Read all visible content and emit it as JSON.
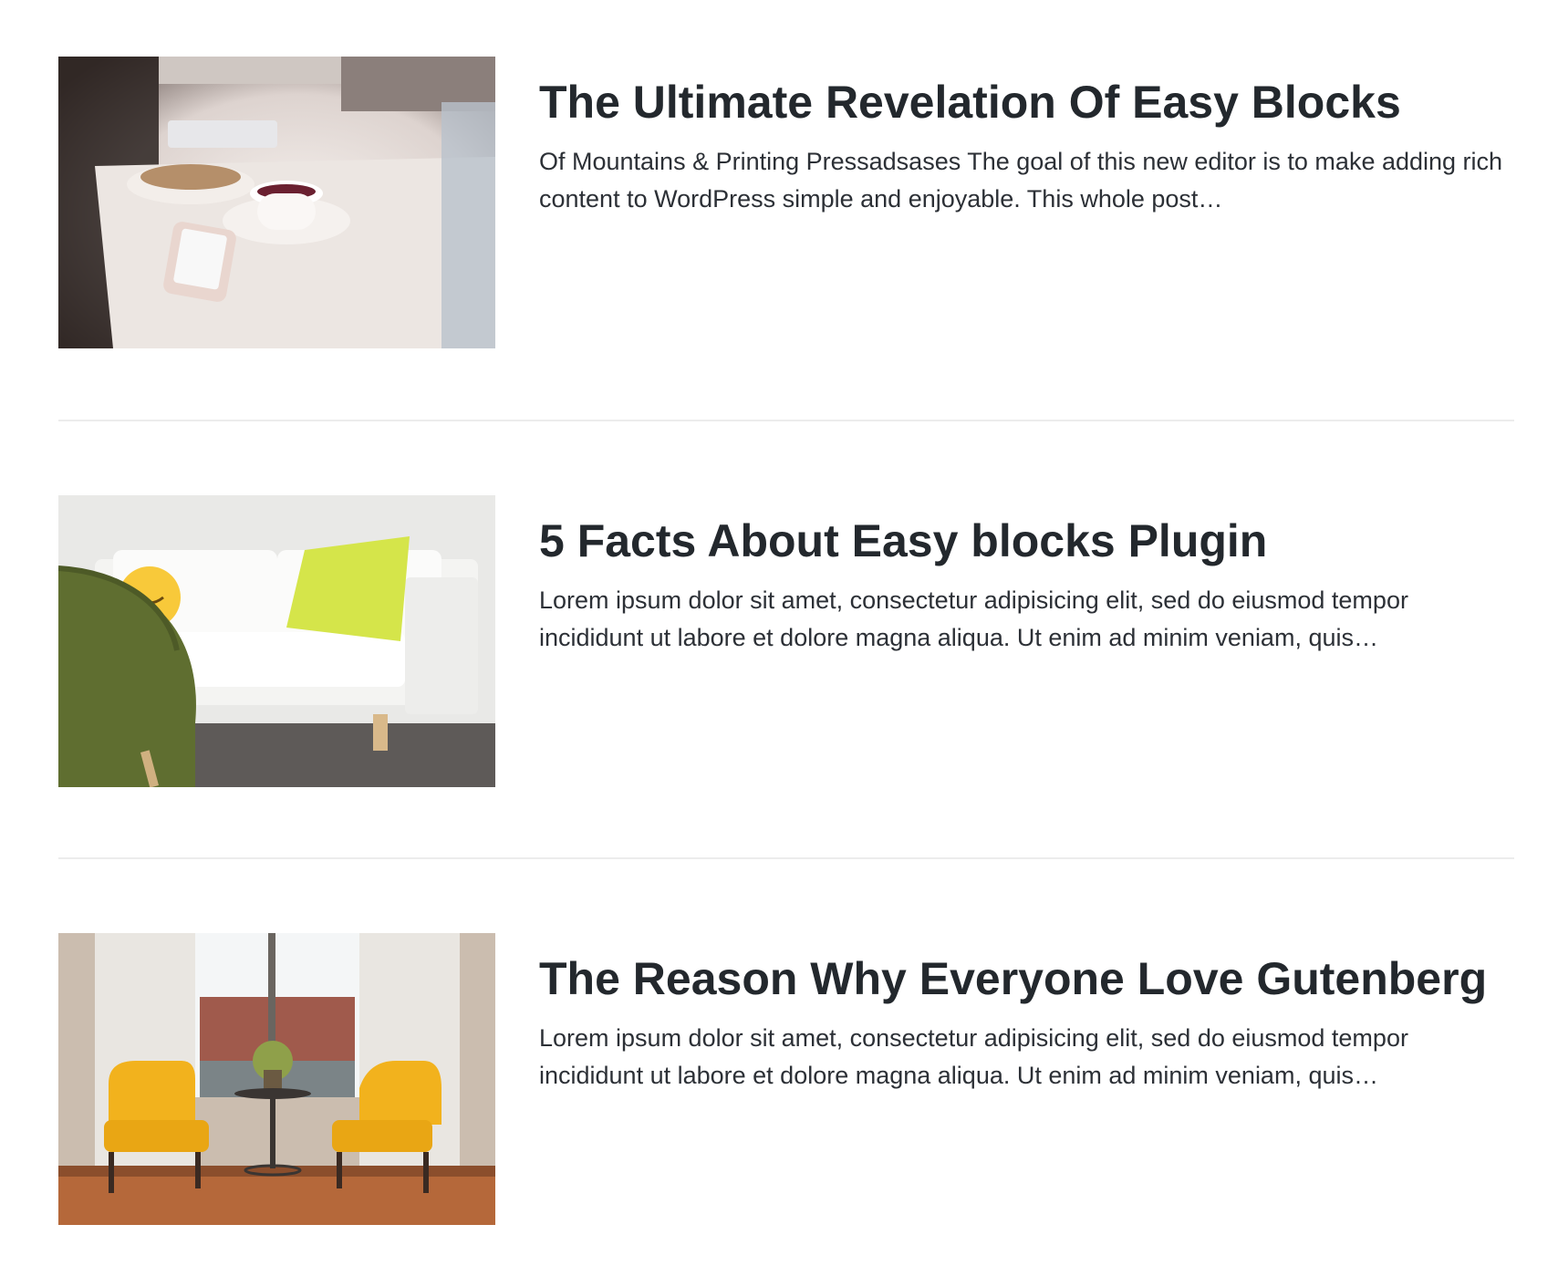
{
  "posts": [
    {
      "title": "The Ultimate Revelation Of Easy Blocks",
      "excerpt": "Of Mountains & Printing Pressadsases The goal of this new editor is to make adding rich content to WordPress simple and enjoyable. This whole post…",
      "thumbnail": "coffee-table-photo"
    },
    {
      "title": "5 Facts About Easy blocks Plugin",
      "excerpt": "Lorem ipsum dolor sit amet, consectetur adipisicing elit, sed do eiusmod tempor incididunt ut labore et dolore magna aliqua. Ut enim ad minim veniam, quis…",
      "thumbnail": "white-sofa-photo"
    },
    {
      "title": "The Reason Why Everyone Love Gutenberg",
      "excerpt": "Lorem ipsum dolor sit amet, consectetur adipisicing elit, sed do eiusmod tempor incididunt ut labore et dolore magna aliqua. Ut enim ad minim veniam, quis…",
      "thumbnail": "yellow-chairs-photo"
    }
  ],
  "colors": {
    "title": "#23282d",
    "text": "#2c3036",
    "divider": "#ececec",
    "background": "#ffffff"
  }
}
